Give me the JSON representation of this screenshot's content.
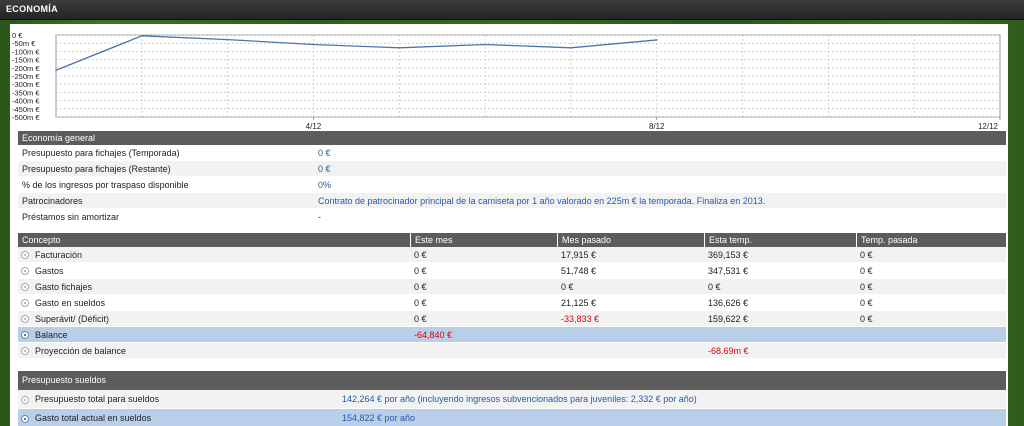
{
  "header": {
    "title": "ECONOMÍA"
  },
  "chart_data": {
    "type": "line",
    "yticks": [
      "0 €",
      "-50m €",
      "-100m €",
      "-150m €",
      "-200m €",
      "-250m €",
      "-300m €",
      "-350m €",
      "-400m €",
      "-450m €",
      "-500m €"
    ],
    "ylim": [
      -500,
      0
    ],
    "xticks": [
      "4/12",
      "8/12",
      "12/12"
    ],
    "grid": true,
    "series": [
      {
        "x": [
          0,
          1,
          2,
          3,
          4,
          5,
          6,
          7
        ],
        "values": [
          -215,
          -5,
          -28,
          -58,
          -78,
          -58,
          -78,
          -30
        ],
        "color": "#4a76a8"
      }
    ],
    "xmax": 11
  },
  "general": {
    "title": "Economía general",
    "rows": [
      {
        "label": "Presupuesto para fichajes (Temporada)",
        "value": "0 €"
      },
      {
        "label": "Presupuesto para fichajes (Restante)",
        "value": "0 €"
      },
      {
        "label": "% de los ingresos por traspaso disponible",
        "value": "0%"
      },
      {
        "label": "Patrocinadores",
        "value": "Contrato de patrocinador principal de la camiseta por 1 año valorado en 225m € la temporada. Finaliza en 2013."
      },
      {
        "label": "Préstamos sin amortizar",
        "value": "-"
      }
    ]
  },
  "concepts": {
    "headers": [
      "Concepto",
      "Este mes",
      "Mes pasado",
      "Esta temp.",
      "Temp. pasada"
    ],
    "rows": [
      {
        "label": "Facturación",
        "cells": [
          "0 €",
          "17,915 €",
          "369,153 €",
          "0 €"
        ]
      },
      {
        "label": "Gastos",
        "cells": [
          "0 €",
          "51,748 €",
          "347,531 €",
          "0 €"
        ]
      },
      {
        "label": "Gasto fichajes",
        "cells": [
          "0 €",
          "0 €",
          "0 €",
          "0 €"
        ]
      },
      {
        "label": "Gasto en sueldos",
        "cells": [
          "0 €",
          "21,125 €",
          "136,626 €",
          "0 €"
        ]
      },
      {
        "label": "Superávit/ (Déficit)",
        "cells": [
          "0 €",
          "-33,833 €",
          "159,622 €",
          "0 €"
        ]
      },
      {
        "label": "Balance",
        "cells": [
          "-64,840 €",
          "",
          "",
          ""
        ]
      },
      {
        "label": "Proyección de balance",
        "cells": [
          "",
          "",
          "-68.69m €",
          ""
        ]
      }
    ]
  },
  "salaries": {
    "title": "Presupuesto sueldos",
    "rows": [
      {
        "label": "Presupuesto total para sueldos",
        "value": "142,264 € por año (incluyendo ingresos subvencionados para juveniles: 2,332 € por año)"
      },
      {
        "label": "Gasto total actual en sueldos",
        "value": "154,822 € por año"
      }
    ]
  }
}
